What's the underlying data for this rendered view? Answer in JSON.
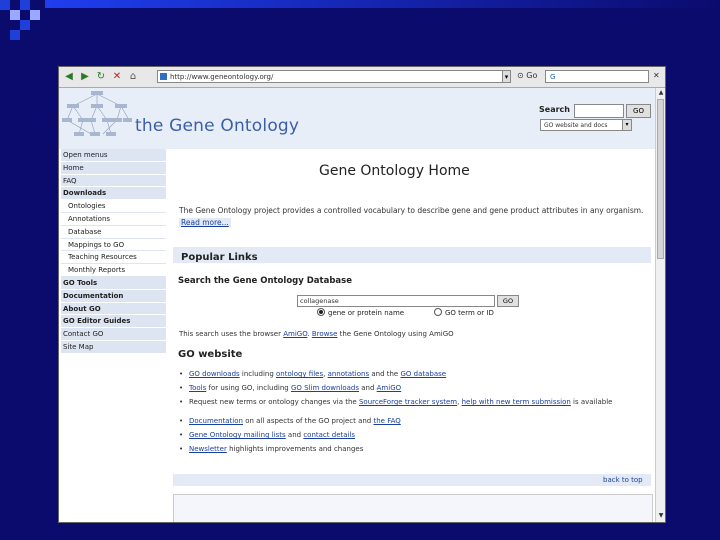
{
  "browser": {
    "url": "http://www.geneontology.org/",
    "search_box_text": "G"
  },
  "site": {
    "logo_text": "the Gene Ontology",
    "search_label": "Search",
    "search_button": "GO",
    "search_scope": "GO website and docs"
  },
  "sidebar": {
    "items": [
      {
        "label": "Open menus"
      },
      {
        "label": "Home"
      },
      {
        "label": "FAQ"
      },
      {
        "label": "Downloads"
      },
      {
        "label": "Ontologies"
      },
      {
        "label": "Annotations"
      },
      {
        "label": "Database"
      },
      {
        "label": "Mappings to GO"
      },
      {
        "label": "Teaching Resources"
      },
      {
        "label": "Monthly Reports"
      },
      {
        "label": "GO Tools"
      },
      {
        "label": "Documentation"
      },
      {
        "label": "About GO"
      },
      {
        "label": "GO Editor Guides"
      },
      {
        "label": "Contact GO"
      },
      {
        "label": "Site Map"
      }
    ]
  },
  "main": {
    "title": "Gene Ontology Home",
    "intro_1": "The Gene Ontology project provides a controlled vocabulary to describe gene and gene product attributes in any organism.",
    "intro_link": "Read more...",
    "popular_links": "Popular Links",
    "db_title": "Search the Gene Ontology Database",
    "db_query": "collagenase",
    "db_button": "GO",
    "radio_1": "gene or protein name",
    "radio_2": "GO term or ID",
    "db_desc_1": "This search uses the browser",
    "db_desc_link_1": "AmiGO",
    "db_desc_link_2": "Browse",
    "db_desc_2": "the Gene Ontology using AmiGO",
    "website_title": "GO website",
    "bullets": [
      {
        "link": "GO downloads",
        "text": "including",
        "link2": "ontology files",
        "mid": ",",
        "link3": "annotations",
        "mid2": "and the",
        "link4": "GO database"
      },
      {
        "link": "Tools",
        "text": "for using GO, including",
        "link2": "GO Slim downloads",
        "mid": "and",
        "link3": "AmiGO"
      },
      {
        "text": "Request new terms or ontology changes via the",
        "link": "SourceForge tracker system",
        "mid": ",",
        "link2": "help with new term submission",
        "text2": "is available"
      },
      {
        "link": "Documentation",
        "text": "on all aspects of the GO project and",
        "link2": "the FAQ"
      },
      {
        "link": "Gene Ontology mailing lists",
        "text": "and",
        "link2": "contact details"
      },
      {
        "link": "Newsletter",
        "text": "highlights improvements and changes"
      }
    ],
    "back_to_top": "back to top"
  },
  "colors": {
    "slide_bg": "#0b0b6e",
    "accent": "#1e3fd8",
    "header_bg": "#e8eef7",
    "link": "#1a40a0"
  }
}
